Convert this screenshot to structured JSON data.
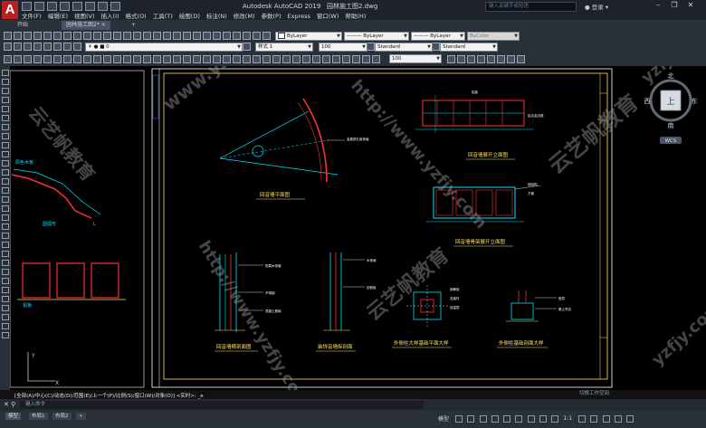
{
  "app": {
    "logo": "A",
    "title": "Autodesk AutoCAD 2019",
    "filename": "园林施工图2.dwg",
    "search_placeholder": "键入关键字或短语",
    "login": "登录"
  },
  "menus": [
    "文件(F)",
    "编辑(E)",
    "视图(V)",
    "插入(I)",
    "格式(O)",
    "工具(T)",
    "绘图(D)",
    "标注(N)",
    "修改(M)",
    "参数(P)",
    "Express",
    "窗口(W)",
    "帮助(H)"
  ],
  "tabs": [
    {
      "label": "开始"
    },
    {
      "label": "园林施工图2*"
    }
  ],
  "toolbar": {
    "layer": "0",
    "color": "ByLayer",
    "linetype": "ByLayer",
    "lineweight": "ByLayer",
    "plotstyle": "ByColor",
    "dimstyle": "样式 1",
    "scale": "100",
    "textstyle": "Standard",
    "tablestyle": "Standard",
    "zoom": "100"
  },
  "viewcube": {
    "north": "北",
    "south": "南",
    "east": "东",
    "west": "西",
    "center": "上",
    "wcs": "WCS"
  },
  "drawing": {
    "titles": [
      "回音墙平面图",
      "回音墙展开立面图",
      "回音墙骨架展开立面图",
      "回音墙横剖面图",
      "装饰音墙纵剖面",
      "外侧柱大样基础平面大样",
      "外侧柱基础剖面大样"
    ],
    "notes": [
      "金属穿孔板饰面",
      "铝板",
      "铝合金边框",
      "钢结构",
      "方管",
      "防腐木饰面",
      "不锈钢",
      "混凝土基础",
      "垫层",
      "素土夯实",
      "木饰面",
      "回音板",
      "钢骨架",
      "连接件",
      "保温层"
    ],
    "left_labels": [
      "原色木板",
      "圆弧形",
      "L",
      "铝板"
    ],
    "watermarks": [
      "www.yzfjy.com",
      "yzfjy.com",
      "云艺帆教育",
      "http://www.yzfjy.com",
      "云艺帆教育",
      "http://www.yzfjy.com",
      "云艺帆教育",
      "yzfjy.com"
    ]
  },
  "cmd": {
    "history": "[全部(A)/中心(C)/动态(D)/范围(E)/上一个(P)/比例(S)/窗口(W)/对象(O)] <实时>: _e",
    "placeholder": "键入命令",
    "workspace": "切换工作空间"
  },
  "layouts": [
    "模型",
    "布局1",
    "布局2"
  ],
  "status": {
    "model": "模型",
    "scale": "1:1"
  }
}
